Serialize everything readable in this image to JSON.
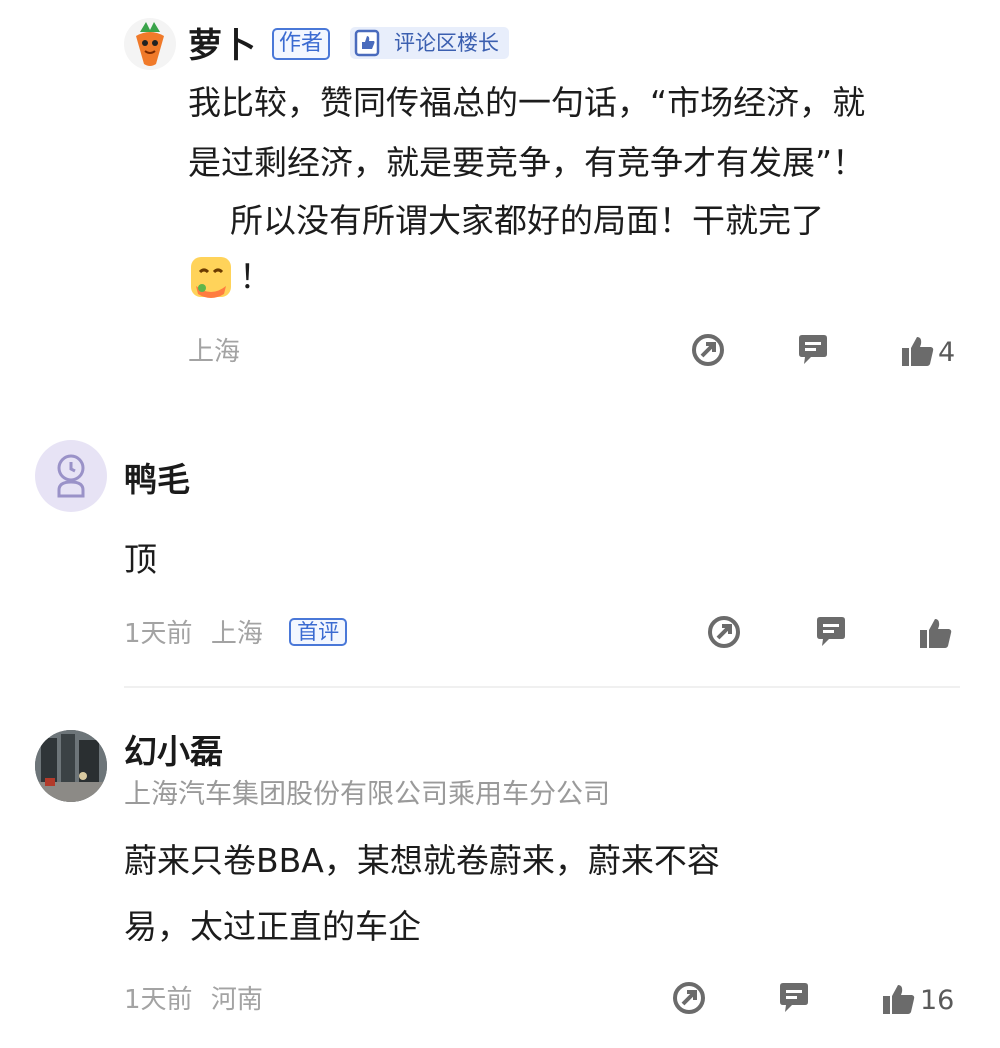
{
  "comments": [
    {
      "username": "萝卜",
      "badges": {
        "author": "作者",
        "owner": "评论区楼长"
      },
      "text_lines": [
        "我比较，赞同传福总的一句话，“市场经济，就",
        "是过剩经济，就是要竞争，有竞争才有发展”！",
        "    所以没有所谓大家都好的局面！干就完了"
      ],
      "text_tail": "！",
      "location": "上海",
      "like_count": "4",
      "icons": {
        "avatar": "carrot-avatar",
        "owner_badge": "thumbs-up-doc-icon",
        "emoji": "hugging-face-emoji",
        "share": "share-arrow-icon",
        "reply": "comment-bubble-icon",
        "like": "thumbs-up-icon"
      }
    },
    {
      "username": "鸭毛",
      "text": "顶",
      "time": "1天前",
      "location": "上海",
      "badge": "首评",
      "like_count": "",
      "icons": {
        "avatar": "default-user-avatar"
      }
    },
    {
      "username": "幻小磊",
      "subtitle": "上海汽车集团股份有限公司乘用车分公司",
      "text_lines": [
        "蔚来只卷BBA，某想就卷蔚来，蔚来不容",
        "易，太过正直的车企"
      ],
      "time": "1天前",
      "location": "河南",
      "like_count": "16",
      "icons": {
        "avatar": "photo-avatar"
      }
    }
  ],
  "colors": {
    "badge_blue": "#3b6bd1",
    "icon_gray": "#6b6b6b",
    "meta_gray": "#a3a3a3"
  }
}
